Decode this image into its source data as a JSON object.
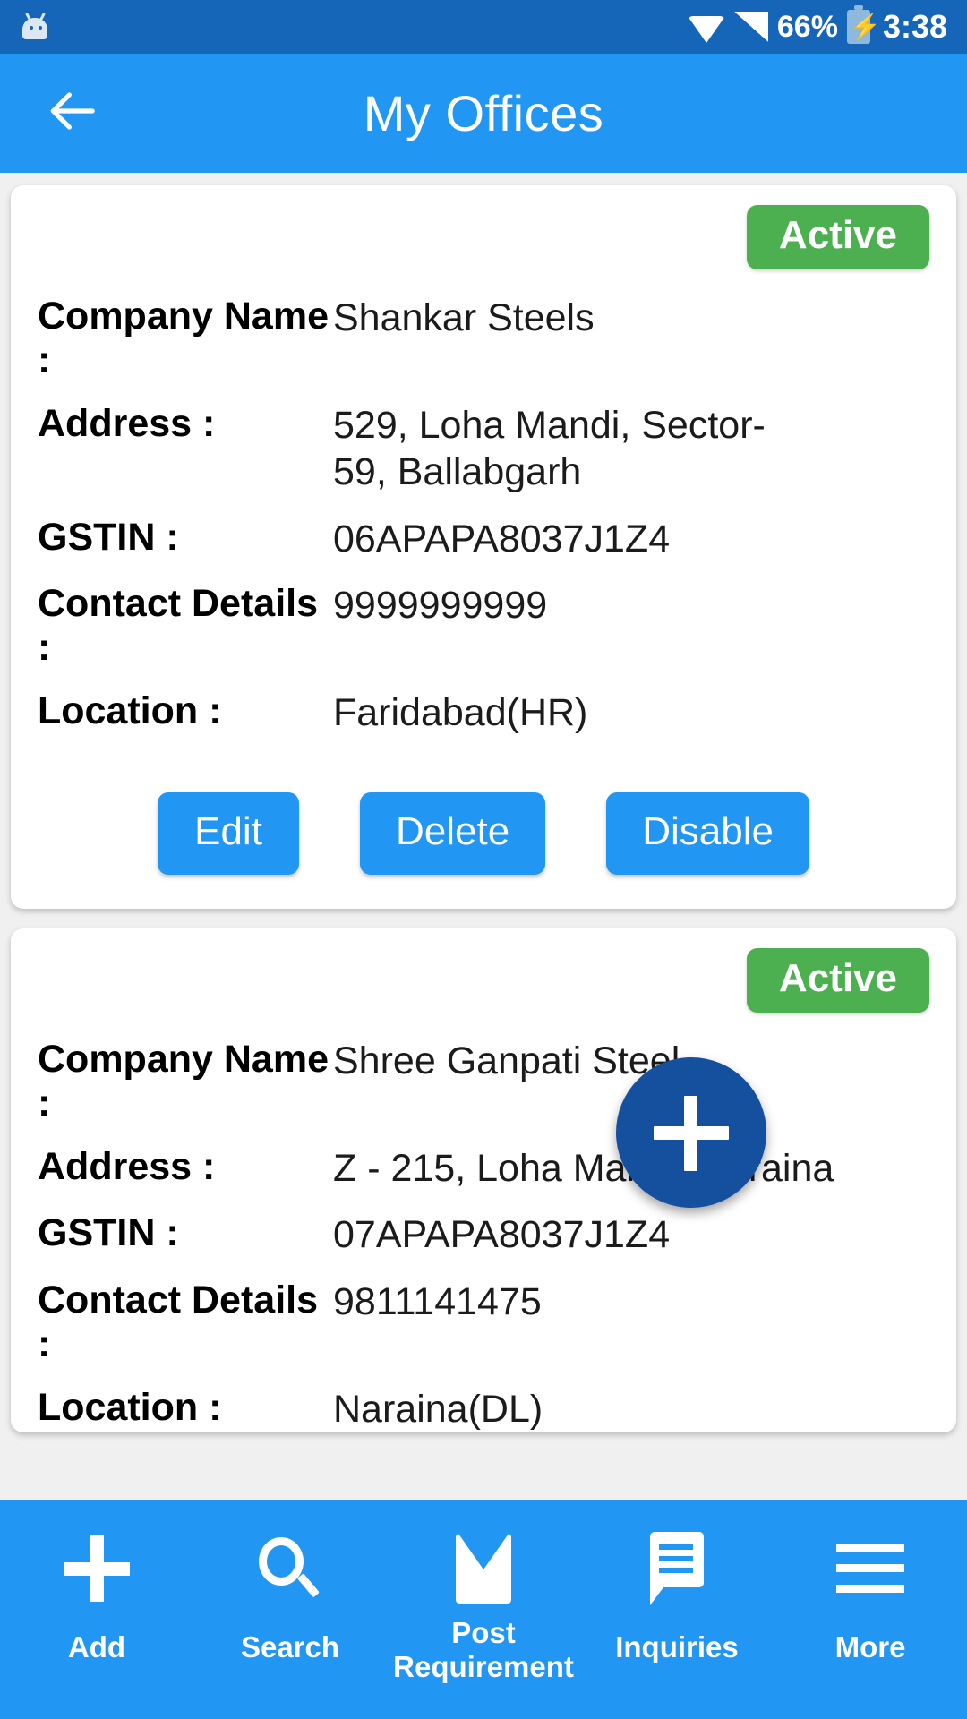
{
  "status_bar": {
    "android_icon": "android-robot-icon",
    "wifi_icon": "wifi-icon",
    "signal_icon": "cellular-signal-icon",
    "battery_percent": "66%",
    "battery_icon": "battery-charging-icon",
    "time": "3:38"
  },
  "app_bar": {
    "back_icon": "back-arrow-icon",
    "title": "My Offices"
  },
  "colors": {
    "status_bar": "#1565b8",
    "app_bar": "#2196f3",
    "accent_blue": "#2196f3",
    "badge_green": "#4caf50",
    "fab_blue": "#14509e",
    "page_background": "#f0f0f0",
    "card_background": "#ffffff"
  },
  "field_labels": {
    "company_name": "Company Name :",
    "address": "Address :",
    "gstin": "GSTIN :",
    "contact_details": "Contact Details :",
    "location": "Location :"
  },
  "offices": [
    {
      "status_badge": "Active",
      "company_name": "Shankar Steels",
      "address": "529, Loha Mandi, Sector-59, Ballabgarh",
      "gstin": "06APAPA8037J1Z4",
      "contact_details": "9999999999",
      "location": "Faridabad(HR)",
      "actions": {
        "edit": "Edit",
        "delete": "Delete",
        "disable": "Disable"
      }
    },
    {
      "status_badge": "Active",
      "company_name": "Shree Ganpati Steel",
      "address": "Z - 215, Loha Mandi, Naraina",
      "gstin": "07APAPA8037J1Z4",
      "contact_details": "9811141475",
      "location": "Naraina(DL)"
    }
  ],
  "fab": {
    "icon": "plus-icon",
    "label": ""
  },
  "bottom_nav": [
    {
      "icon": "plus-icon",
      "label": "Add"
    },
    {
      "icon": "search-icon",
      "label": "Search"
    },
    {
      "icon": "mail-icon",
      "label": "Post\nRequirement",
      "line1": "Post",
      "line2": "Requirement"
    },
    {
      "icon": "chat-bubble-icon",
      "label": "Inquiries"
    },
    {
      "icon": "hamburger-menu-icon",
      "label": "More"
    }
  ]
}
